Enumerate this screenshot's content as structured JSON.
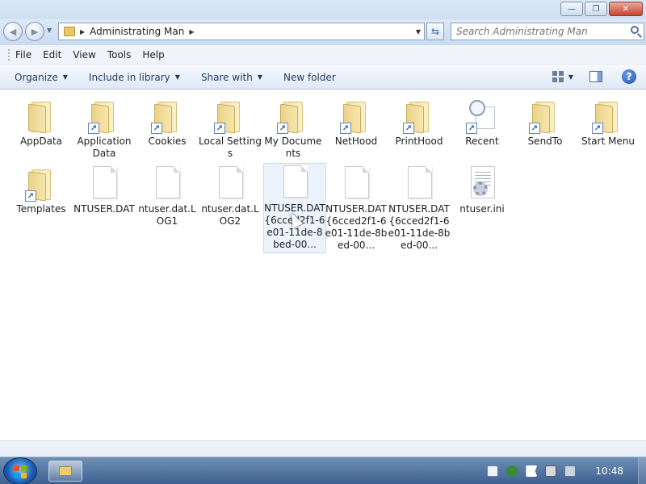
{
  "window": {
    "minimize_glyph": "—",
    "maximize_glyph": "❐",
    "close_glyph": "✕"
  },
  "address": {
    "breadcrumb": "Administrating Man",
    "refresh_glyph": "⇆",
    "search_placeholder": "Search Administrating Man"
  },
  "nav": {
    "back_glyph": "◀",
    "forward_glyph": "▶"
  },
  "menu": [
    "File",
    "Edit",
    "View",
    "Tools",
    "Help"
  ],
  "commands": {
    "organize": "Organize",
    "include_in_library": "Include in library",
    "share_with": "Share with",
    "new_folder": "New folder",
    "help_glyph": "?"
  },
  "items": [
    {
      "label": "AppData",
      "type": "folder",
      "shortcut": false
    },
    {
      "label": "Application Data",
      "type": "folder",
      "shortcut": true
    },
    {
      "label": "Cookies",
      "type": "folder",
      "shortcut": true
    },
    {
      "label": "Local Settings",
      "type": "folder",
      "shortcut": true
    },
    {
      "label": "My Documents",
      "type": "folder",
      "shortcut": true
    },
    {
      "label": "NetHood",
      "type": "folder",
      "shortcut": true
    },
    {
      "label": "PrintHood",
      "type": "folder",
      "shortcut": true
    },
    {
      "label": "Recent",
      "type": "recent",
      "shortcut": true
    },
    {
      "label": "SendTo",
      "type": "folder",
      "shortcut": true
    },
    {
      "label": "Start Menu",
      "type": "folder",
      "shortcut": true
    },
    {
      "label": "Templates",
      "type": "folder",
      "shortcut": true
    },
    {
      "label": "NTUSER.DAT",
      "type": "file",
      "shortcut": false
    },
    {
      "label": "ntuser.dat.LOG1",
      "type": "file",
      "shortcut": false
    },
    {
      "label": "ntuser.dat.LOG2",
      "type": "file",
      "shortcut": false
    },
    {
      "label": "NTUSER.DAT{6cced2f1-6e01-11de-8bed-00...",
      "type": "file",
      "shortcut": false,
      "selected": true
    },
    {
      "label": "NTUSER.DAT{6cced2f1-6e01-11de-8bed-00...",
      "type": "file",
      "shortcut": false
    },
    {
      "label": "NTUSER.DAT{6cced2f1-6e01-11de-8bed-00...",
      "type": "file",
      "shortcut": false
    },
    {
      "label": "ntuser.ini",
      "type": "ini",
      "shortcut": false
    }
  ],
  "taskbar": {
    "clock": "10:48"
  },
  "colors": {
    "accent": "#1e3a5f",
    "selection": "#d2e4f8"
  }
}
